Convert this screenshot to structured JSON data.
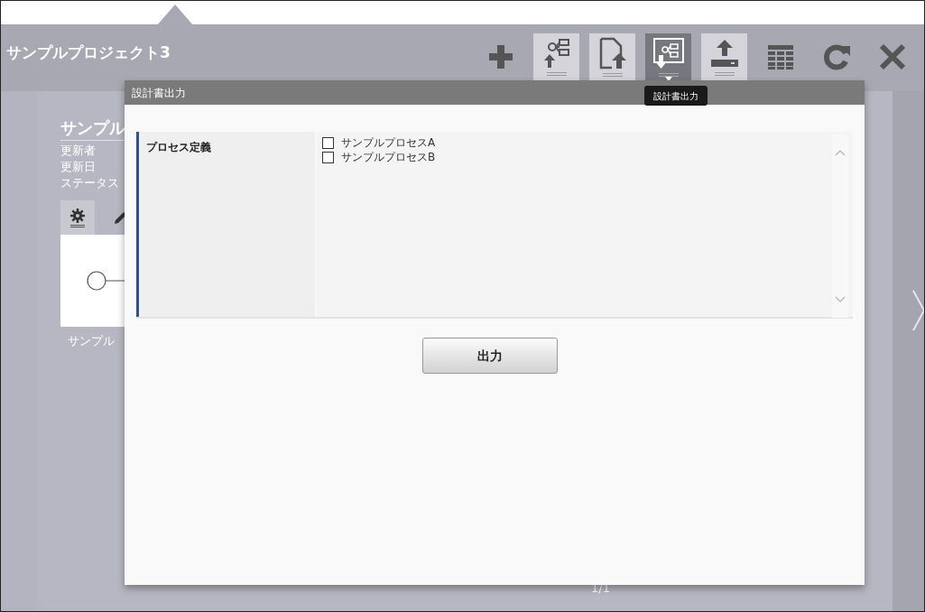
{
  "project": {
    "title": "サンプルプロジェクト3"
  },
  "toolbar": [
    {
      "kind": "plus",
      "tile": false,
      "selected": false
    },
    {
      "kind": "flow-upload",
      "tile": true,
      "selected": false
    },
    {
      "kind": "document-upload",
      "tile": true,
      "selected": false
    },
    {
      "kind": "design-output",
      "tile": true,
      "selected": true
    },
    {
      "kind": "tray-upload",
      "tile": true,
      "selected": false
    },
    {
      "kind": "table",
      "tile": false,
      "selected": false
    },
    {
      "kind": "refresh",
      "tile": false,
      "selected": false
    },
    {
      "kind": "close",
      "tile": false,
      "selected": false
    }
  ],
  "tooltip": "設計書出力",
  "card": {
    "title": "サンプル",
    "fields": [
      "更新者",
      "更新日",
      "ステータス"
    ],
    "caption": "サンプル"
  },
  "pager": "1/1",
  "dialog": {
    "title": "設計書出力",
    "section_label": "プロセス定義",
    "options": [
      {
        "label": "サンプルプロセスA",
        "checked": false
      },
      {
        "label": "サンプルプロセスB",
        "checked": false
      }
    ],
    "button": "出力"
  }
}
